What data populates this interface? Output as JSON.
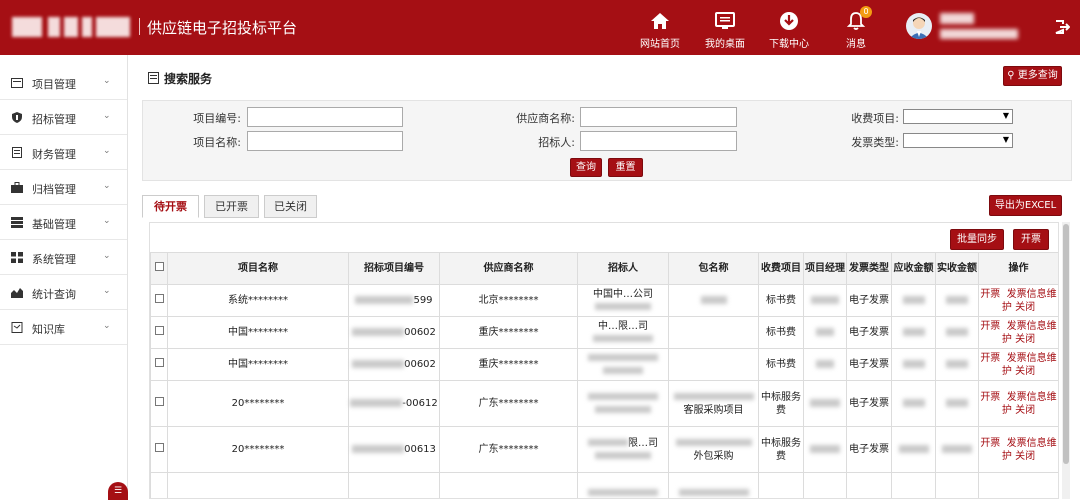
{
  "header": {
    "app_title": "供应链电子招投标平台",
    "nav": [
      {
        "label": "网站首页",
        "icon": "home-icon"
      },
      {
        "label": "我的桌面",
        "icon": "desktop-icon"
      },
      {
        "label": "下载中心",
        "icon": "download-icon"
      },
      {
        "label": "消息",
        "icon": "bell-icon",
        "badge": "0"
      }
    ]
  },
  "sidebar": {
    "items": [
      {
        "label": "项目管理",
        "icon": "folder-icon"
      },
      {
        "label": "招标管理",
        "icon": "shield-icon"
      },
      {
        "label": "财务管理",
        "icon": "ledger-icon"
      },
      {
        "label": "归档管理",
        "icon": "briefcase-icon"
      },
      {
        "label": "基础管理",
        "icon": "server-icon"
      },
      {
        "label": "系统管理",
        "icon": "grid-icon"
      },
      {
        "label": "统计查询",
        "icon": "chart-icon"
      },
      {
        "label": "知识库",
        "icon": "book-icon"
      }
    ]
  },
  "panel": {
    "title": "搜索服务",
    "more_search": "更多查询"
  },
  "search": {
    "project_no_label": "项目编号:",
    "supplier_label": "供应商名称:",
    "fee_item_label": "收费项目:",
    "project_name_label": "项目名称:",
    "tenderer_label": "招标人:",
    "invoice_type_label": "发票类型:",
    "query_btn": "查询",
    "reset_btn": "重置"
  },
  "tabs": [
    "待开票",
    "已开票",
    "已关闭"
  ],
  "actions": {
    "export": "导出为EXCEL",
    "batch_sync": "批量同步",
    "invoice": "开票"
  },
  "table": {
    "headers": [
      "项目名称",
      "招标项目编号",
      "供应商名称",
      "招标人",
      "包名称",
      "收费项目",
      "项目经理",
      "发票类型",
      "应收金额",
      "实收金额",
      "操作"
    ],
    "rows": [
      {
        "name": "系统********",
        "code_tail": "599",
        "supplier": "北京********",
        "tenderer": "中国中…公司",
        "package": "",
        "fee": "标书费",
        "invoice_type": "电子发票"
      },
      {
        "name": "中国********",
        "code_tail": "00602",
        "supplier": "重庆********",
        "tenderer": "中…限…司",
        "package": "",
        "fee": "标书费",
        "invoice_type": "电子发票"
      },
      {
        "name": "中国********",
        "code_tail": "00602",
        "supplier": "重庆********",
        "tenderer": "",
        "package": "",
        "fee": "标书费",
        "invoice_type": "电子发票"
      },
      {
        "name": "20********",
        "code_tail": "-00612",
        "supplier": "广东********",
        "tenderer": "",
        "package": "客服采购项目",
        "fee": "中标服务费",
        "invoice_type": "电子发票"
      },
      {
        "name": "20********",
        "code_tail": "00613",
        "supplier": "广东********",
        "tenderer": "限…司",
        "package": "外包采购",
        "fee": "中标服务费",
        "invoice_type": "电子发票"
      }
    ],
    "ops": {
      "open": "开票",
      "info": "发票信息维护",
      "close": "关闭"
    }
  }
}
